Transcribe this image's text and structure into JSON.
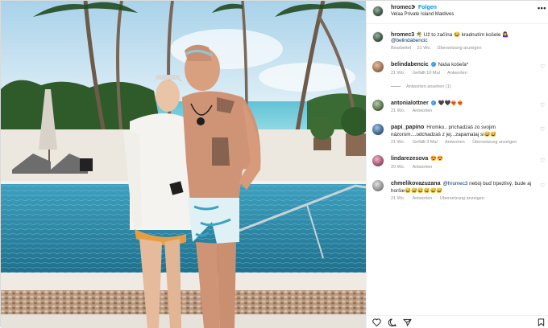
{
  "post": {
    "username": "hromec3",
    "separator": "•",
    "follow_label": "Folgen",
    "location": "Velaa Private Island Maldives",
    "more_label": "•••"
  },
  "caption": {
    "username": "hromec3",
    "text": "🌴 Už to začína 😂 kradnutím košele 🤷‍♀️",
    "mention": "@belindabencic",
    "edited": "Bearbeitet",
    "age": "21 Wo.",
    "translate": "Übersetzung anzeigen"
  },
  "comments": [
    {
      "username": "belindabencic",
      "verified": true,
      "text": "Naša košeľa*",
      "age": "21 Wo.",
      "likes": "Gefällt 10 Mal",
      "reply": "Antworten",
      "view_replies": "Antworten ansehen (1)",
      "avatar_color": "#c98a5a"
    },
    {
      "username": "antonialottner",
      "verified": true,
      "text": "🖤🖤❤️‍🔥❤️‍🔥",
      "age": "21 Wo.",
      "reply": "Antworten",
      "avatar_color": "#6a8a5e"
    },
    {
      "username": "papi_papino",
      "text": "Hromko.. prichadzaš zo svojim názorom....odchadzaš z jej...zapamataj si😅😅",
      "age": "21 Wo.",
      "likes": "Gefällt 3 Mal",
      "reply": "Antworten",
      "translate": "Übersetzung anzeigen",
      "avatar_color": "#3a5f8a"
    },
    {
      "username": "lindarezesova",
      "text": "😍😍",
      "age": "20 Wo.",
      "reply": "Antworten",
      "avatar_color": "#b0607a"
    },
    {
      "username": "chmelikovazuzana",
      "text": "@hromec3 neboj buď trpezlivý, bude aj horšie😅😅😅😅😅😅",
      "mention": "@hromec3",
      "age": "21 Wo.",
      "reply": "Antworten",
      "translate": "Übersetzung anzeigen",
      "avatar_color": "#9a9a9a"
    }
  ],
  "actions": {
    "like": "heart-icon",
    "comment": "comment-icon",
    "share": "share-icon",
    "save": "bookmark-icon"
  },
  "colors": {
    "link": "#0095f6",
    "mention": "#00376b",
    "muted": "#8e8e8e",
    "sky": "#cfe6f2",
    "sea": "#6fc7d8",
    "pool": "#2f8fb0"
  }
}
